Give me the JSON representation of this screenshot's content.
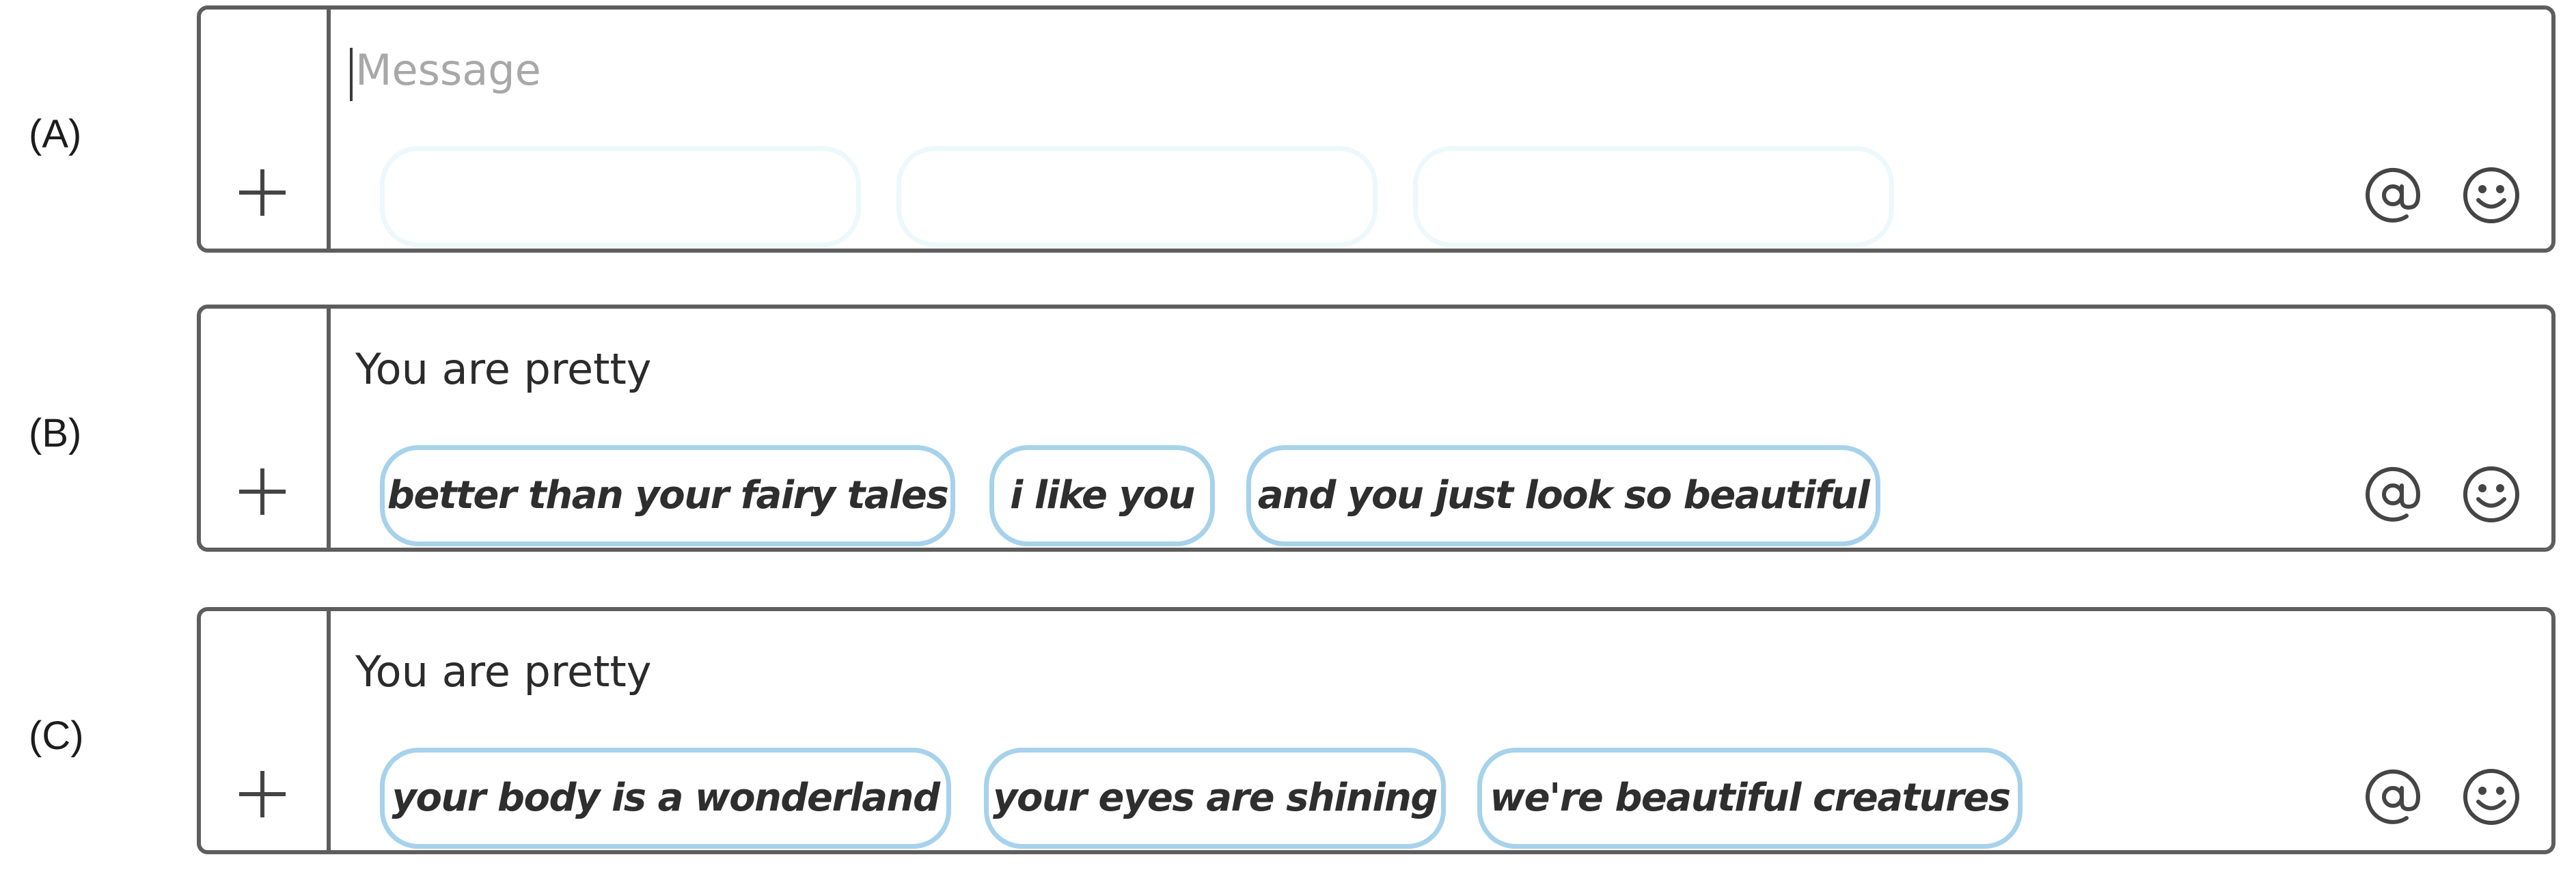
{
  "rows": [
    {
      "label": "(A)",
      "message_placeholder": "Message",
      "message_text": "",
      "suggestions": [
        "",
        "",
        ""
      ]
    },
    {
      "label": "(B)",
      "message_text": "You are pretty",
      "suggestions": [
        "better than your fairy tales",
        "i like you",
        "and you just look so beautiful"
      ]
    },
    {
      "label": "(C)",
      "message_text": "You are pretty",
      "suggestions": [
        "your body is a wonderland",
        "your eyes are shining",
        "we're beautiful creatures"
      ]
    }
  ],
  "icons": {
    "attach": "plus-icon",
    "mention": "at-sign-icon",
    "emoji": "smiley-face-icon"
  },
  "colors": {
    "chip_border": "#a6d2ec",
    "chip_border_empty": "#ecf8fc",
    "frame": "#5e5e5e",
    "placeholder": "#a8a8a8"
  }
}
